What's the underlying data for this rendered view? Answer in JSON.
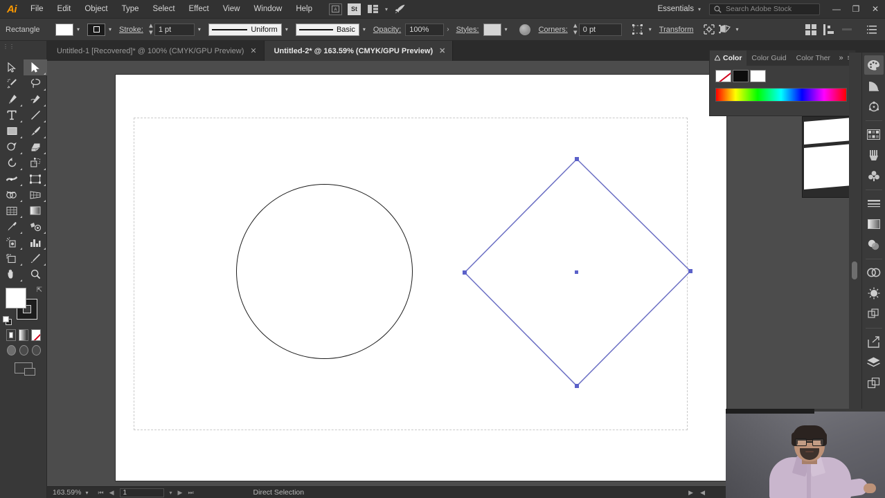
{
  "app": {
    "logo": "Ai",
    "name": "Adobe Illustrator"
  },
  "menubar": {
    "items": [
      "File",
      "Edit",
      "Object",
      "Type",
      "Select",
      "Effect",
      "View",
      "Window",
      "Help"
    ],
    "icons": [
      {
        "name": "bridge-icon",
        "label": "Br"
      },
      {
        "name": "adobe-stock-icon",
        "label": "St"
      },
      {
        "name": "arrange-documents-icon",
        "label": "▤"
      },
      {
        "name": "arrange-chevron-icon",
        "label": "▾"
      },
      {
        "name": "discover-rocket-icon",
        "label": "➤"
      }
    ],
    "workspace": {
      "label": "Essentials",
      "chevron": "▾"
    },
    "search": {
      "placeholder": "Search Adobe Stock",
      "icon": "search-icon"
    },
    "window_controls": {
      "minimize": "—",
      "restore": "❐",
      "close": "✕"
    }
  },
  "controlbar": {
    "object_label": "Rectangle",
    "fill_swatch_color": "#ffffff",
    "stroke_swatch_color": "#1a1a1a",
    "stroke_label": "Stroke:",
    "stroke_weight": "1 pt",
    "profile_label": "Uniform",
    "brush_label": "Basic",
    "opacity_label": "Opacity:",
    "opacity_value": "100%",
    "styles_label": "Styles:",
    "style_swatch_color": "#d5d5d5",
    "corners_label": "Corners:",
    "corners_value": "0 pt",
    "transform_label": "Transform",
    "icons": [
      {
        "name": "align-icon"
      },
      {
        "name": "opacity-globe-icon"
      },
      {
        "name": "select-similar-icon"
      },
      {
        "name": "isolate-icon"
      },
      {
        "name": "shape-builder-icon"
      },
      {
        "name": "distribute-icon"
      },
      {
        "name": "arrange-icon"
      },
      {
        "name": "panel-menu-icon"
      }
    ]
  },
  "tabs": [
    {
      "label": "Untitled-1 [Recovered]* @ 100% (CMYK/GPU Preview)",
      "active": false,
      "close": "✕"
    },
    {
      "label": "Untitled-2* @ 163.59% (CMYK/GPU Preview)",
      "active": true,
      "close": "✕"
    }
  ],
  "toolbar": {
    "grab_handle": "⋮⋮",
    "tools": [
      {
        "name": "selection-tool",
        "label": "Selection",
        "active": false
      },
      {
        "name": "direct-selection-tool",
        "label": "Direct Selection",
        "active": true
      },
      {
        "name": "magic-wand-tool",
        "label": "Magic Wand",
        "active": false
      },
      {
        "name": "lasso-tool",
        "label": "Lasso",
        "active": false
      },
      {
        "name": "pen-tool",
        "label": "Pen",
        "active": false
      },
      {
        "name": "curvature-tool",
        "label": "Curvature",
        "active": false
      },
      {
        "name": "type-tool",
        "label": "Type",
        "active": false
      },
      {
        "name": "line-segment-tool",
        "label": "Line Segment",
        "active": false
      },
      {
        "name": "rectangle-tool",
        "label": "Rectangle",
        "active": false
      },
      {
        "name": "paintbrush-tool",
        "label": "Paintbrush",
        "active": false
      },
      {
        "name": "shaper-tool",
        "label": "Shaper",
        "active": false
      },
      {
        "name": "eraser-tool",
        "label": "Eraser",
        "active": false
      },
      {
        "name": "rotate-tool",
        "label": "Rotate",
        "active": false
      },
      {
        "name": "scale-tool",
        "label": "Scale",
        "active": false
      },
      {
        "name": "width-tool",
        "label": "Width",
        "active": false
      },
      {
        "name": "free-transform-tool",
        "label": "Free Transform",
        "active": false
      },
      {
        "name": "shape-builder-tool",
        "label": "Shape Builder",
        "active": false
      },
      {
        "name": "perspective-grid-tool",
        "label": "Perspective Grid",
        "active": false
      },
      {
        "name": "mesh-tool",
        "label": "Mesh",
        "active": false
      },
      {
        "name": "gradient-tool",
        "label": "Gradient",
        "active": false
      },
      {
        "name": "eyedropper-tool",
        "label": "Eyedropper",
        "active": false
      },
      {
        "name": "blend-tool",
        "label": "Blend",
        "active": false
      },
      {
        "name": "symbol-sprayer-tool",
        "label": "Symbol Sprayer",
        "active": false
      },
      {
        "name": "column-graph-tool",
        "label": "Column Graph",
        "active": false
      },
      {
        "name": "artboard-tool",
        "label": "Artboard",
        "active": false
      },
      {
        "name": "slice-tool",
        "label": "Slice",
        "active": false
      },
      {
        "name": "hand-tool",
        "label": "Hand",
        "active": false
      },
      {
        "name": "zoom-tool",
        "label": "Zoom",
        "active": false
      }
    ],
    "fill_color": "#ffffff",
    "stroke_color": "#1c1c1c",
    "swap_icon": "swap-fill-stroke-icon",
    "default_icon": "default-fill-stroke-icon",
    "fill_modes": [
      "color-mode",
      "gradient-mode",
      "none-mode"
    ],
    "draw_modes": [
      "draw-normal",
      "draw-behind",
      "draw-inside"
    ],
    "screen_mode": "change-screen-mode"
  },
  "canvas": {
    "background_color": "#4c4c4c",
    "document_background": "#ffffff",
    "artboard_border_color": "#c9c9c9",
    "shapes": [
      {
        "name": "ellipse-shape",
        "type": "circle",
        "stroke": "#1a1a1a",
        "fill": "none",
        "selected": false
      },
      {
        "name": "rotated-square-shape",
        "type": "diamond",
        "stroke": "#6b6fc4",
        "fill": "none",
        "selected": true,
        "anchor_color": "#5b61c9",
        "anchors": 4,
        "center_point": true
      }
    ],
    "cursor": "direct-selection-cursor"
  },
  "color_panel": {
    "tabs": [
      {
        "label": "Color",
        "active": true
      },
      {
        "label": "Color Guid",
        "active": false
      },
      {
        "label": "Color Ther",
        "active": false
      }
    ],
    "expand_icon": "»",
    "menu_icon": "≡",
    "swatches": [
      {
        "name": "none-swatch",
        "color": "none"
      },
      {
        "name": "black-swatch",
        "color": "#0d0d0d"
      },
      {
        "name": "white-swatch",
        "color": "#ffffff"
      }
    ],
    "spectrum": "color-spectrum-ramp"
  },
  "right_rail": {
    "icons": [
      {
        "name": "color-panel-icon",
        "active": true
      },
      {
        "name": "color-guide-icon",
        "active": false
      },
      {
        "name": "color-themes-icon",
        "active": false
      },
      {
        "name": "swatches-icon",
        "active": false
      },
      {
        "name": "brushes-icon",
        "active": false
      },
      {
        "name": "symbols-icon",
        "active": false
      },
      {
        "name": "stroke-panel-icon",
        "active": false
      },
      {
        "name": "gradient-panel-icon",
        "active": false
      },
      {
        "name": "transparency-icon",
        "active": false
      },
      {
        "name": "creative-cloud-libraries-icon",
        "active": false
      },
      {
        "name": "appearance-icon",
        "active": false
      },
      {
        "name": "pathfinder-icon",
        "active": false
      },
      {
        "name": "export-icon",
        "active": false
      },
      {
        "name": "layers-icon",
        "active": false
      },
      {
        "name": "artboards-icon",
        "active": false
      }
    ]
  },
  "statusbar": {
    "zoom_value": "163.59%",
    "zoom_chevron": "▾",
    "nav_first": "⏮",
    "nav_prev": "◀",
    "artboard_number": "1",
    "artboard_chevron": "▾",
    "nav_next": "▶",
    "nav_last": "⏭",
    "current_tool": "Direct Selection",
    "right_arrow": "▶",
    "left_arrow": "◀"
  },
  "webcam": {
    "name": "webcam-overlay",
    "description": "Presenter on camera"
  }
}
